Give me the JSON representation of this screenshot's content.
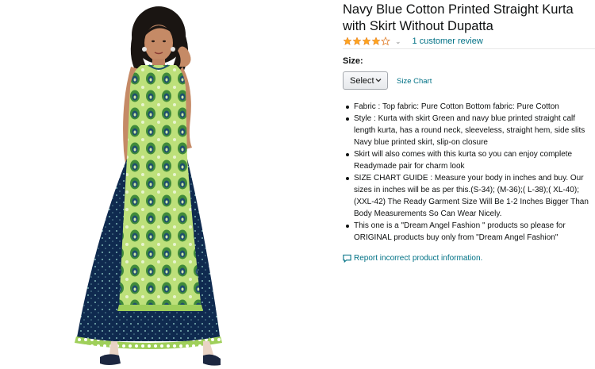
{
  "product": {
    "title": "Navy Blue Cotton Printed Straight Kurta with Skirt Without Dupatta",
    "rating_stars": 4,
    "rating_max": 5,
    "review_link": "1 customer review"
  },
  "size": {
    "label": "Size:",
    "select_value": "Select",
    "size_chart_link": "Size Chart"
  },
  "bullets": [
    "Fabric : Top fabric: Pure Cotton Bottom fabric: Pure Cotton",
    "Style : Kurta with skirt Green and navy blue printed straight calf length kurta, has a round neck, sleeveless, straight hem, side slits Navy blue printed skirt, slip-on closure",
    "Skirt will also comes with this kurta so you can enjoy complete Readymade pair for charm look",
    "SIZE CHART GUIDE : Measure your body in inches and buy. Our sizes in inches will be as per this.(S-34); (M-36);( L-38);( XL-40); (XXL-42) The Ready Garment Size Will Be 1-2 Inches Bigger Than Body Measurements So Can Wear Nicely.",
    "This one is a \"Dream Angel Fashion \" products so please for ORIGINAL products buy only from \"Dream Angel Fashion\""
  ],
  "report": {
    "link": "Report incorrect product information."
  },
  "colors": {
    "link": "#007185",
    "star": "#ffa41c",
    "text": "#0f1111"
  },
  "icons": {
    "star": "star-icon",
    "chevron": "chevron-down-icon",
    "report": "comment-icon"
  }
}
